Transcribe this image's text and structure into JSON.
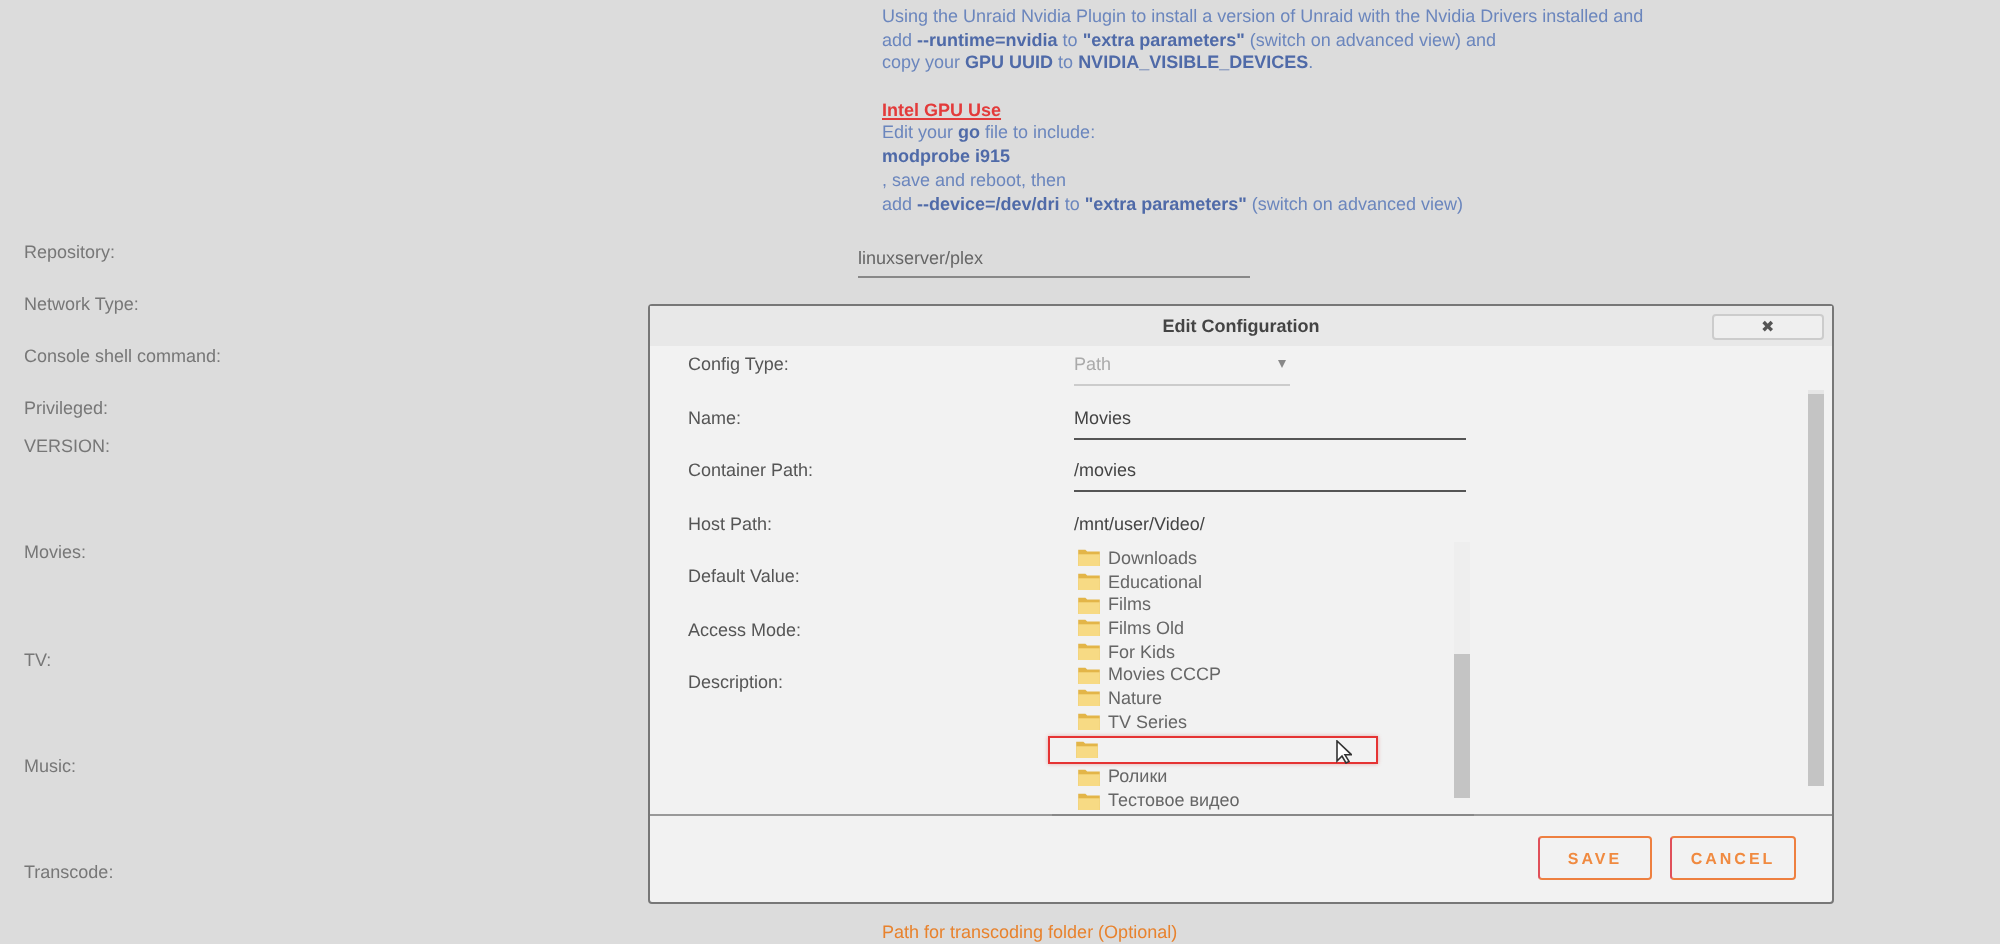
{
  "help_text": [
    {
      "kind": "text",
      "text": "Using the Unraid Nvidia Plugin to install a version of Unraid with the Nvidia Drivers installed and"
    },
    {
      "kind": "text",
      "text": "add **--runtime=nvidia** to **\"extra parameters\"** (switch on advanced view) and"
    },
    {
      "kind": "text",
      "text": "copy your **GPU UUID** to **NVIDIA_VISIBLE_DEVICES**."
    },
    {
      "kind": "gap"
    },
    {
      "kind": "heading",
      "text": "Intel GPU Use"
    },
    {
      "kind": "text",
      "text": "Edit your **go** file to include:"
    },
    {
      "kind": "text",
      "text": "**modprobe i915**"
    },
    {
      "kind": "text",
      "text": ", save and reboot, then"
    },
    {
      "kind": "text",
      "text": "add **--device=/dev/dri** to **\"extra parameters\"** (switch on advanced view)"
    }
  ],
  "settings": [
    {
      "label": "Repository:",
      "value": "linuxserver/plex"
    },
    {
      "label": "Network Type:"
    },
    {
      "label": "Console shell command:"
    },
    {
      "label": "Privileged:"
    },
    {
      "label": "VERSION:"
    },
    {
      "label": "Movies:"
    },
    {
      "label": "TV:"
    },
    {
      "label": "Music:"
    },
    {
      "label": "Transcode:"
    }
  ],
  "transcode_hint": "Path for transcoding folder (Optional)",
  "dialog": {
    "title": "Edit Configuration",
    "close": "✖",
    "fields": [
      {
        "label": "Config Type:",
        "kind": "select",
        "value": "Path",
        "disabled": true
      },
      {
        "label": "Name:",
        "kind": "input",
        "value": "Movies",
        "disabled": false
      },
      {
        "label": "Container Path:",
        "kind": "input",
        "value": "/movies",
        "disabled": false
      },
      {
        "label": "Host Path:",
        "kind": "input",
        "value": "/mnt/user/Video/",
        "disabled": false
      },
      {
        "label": "Default Value:",
        "kind": "blank"
      },
      {
        "label": "Access Mode:",
        "kind": "blank"
      },
      {
        "label": "Description:",
        "kind": "blank"
      }
    ],
    "folders": [
      {
        "name": "Downloads",
        "highlighted": false
      },
      {
        "name": "Educational",
        "highlighted": false
      },
      {
        "name": "Films",
        "highlighted": false
      },
      {
        "name": "Films Old",
        "highlighted": false
      },
      {
        "name": "For Kids",
        "highlighted": false
      },
      {
        "name": "Movies CCCP",
        "highlighted": false
      },
      {
        "name": "Nature",
        "highlighted": false
      },
      {
        "name": "TV Series",
        "highlighted": false
      },
      {
        "highlighted": true
      },
      {
        "name": "Ролики",
        "highlighted": false
      },
      {
        "name": "Тестовое видео",
        "highlighted": false
      }
    ],
    "buttons": [
      "SAVE",
      "CANCEL"
    ]
  }
}
